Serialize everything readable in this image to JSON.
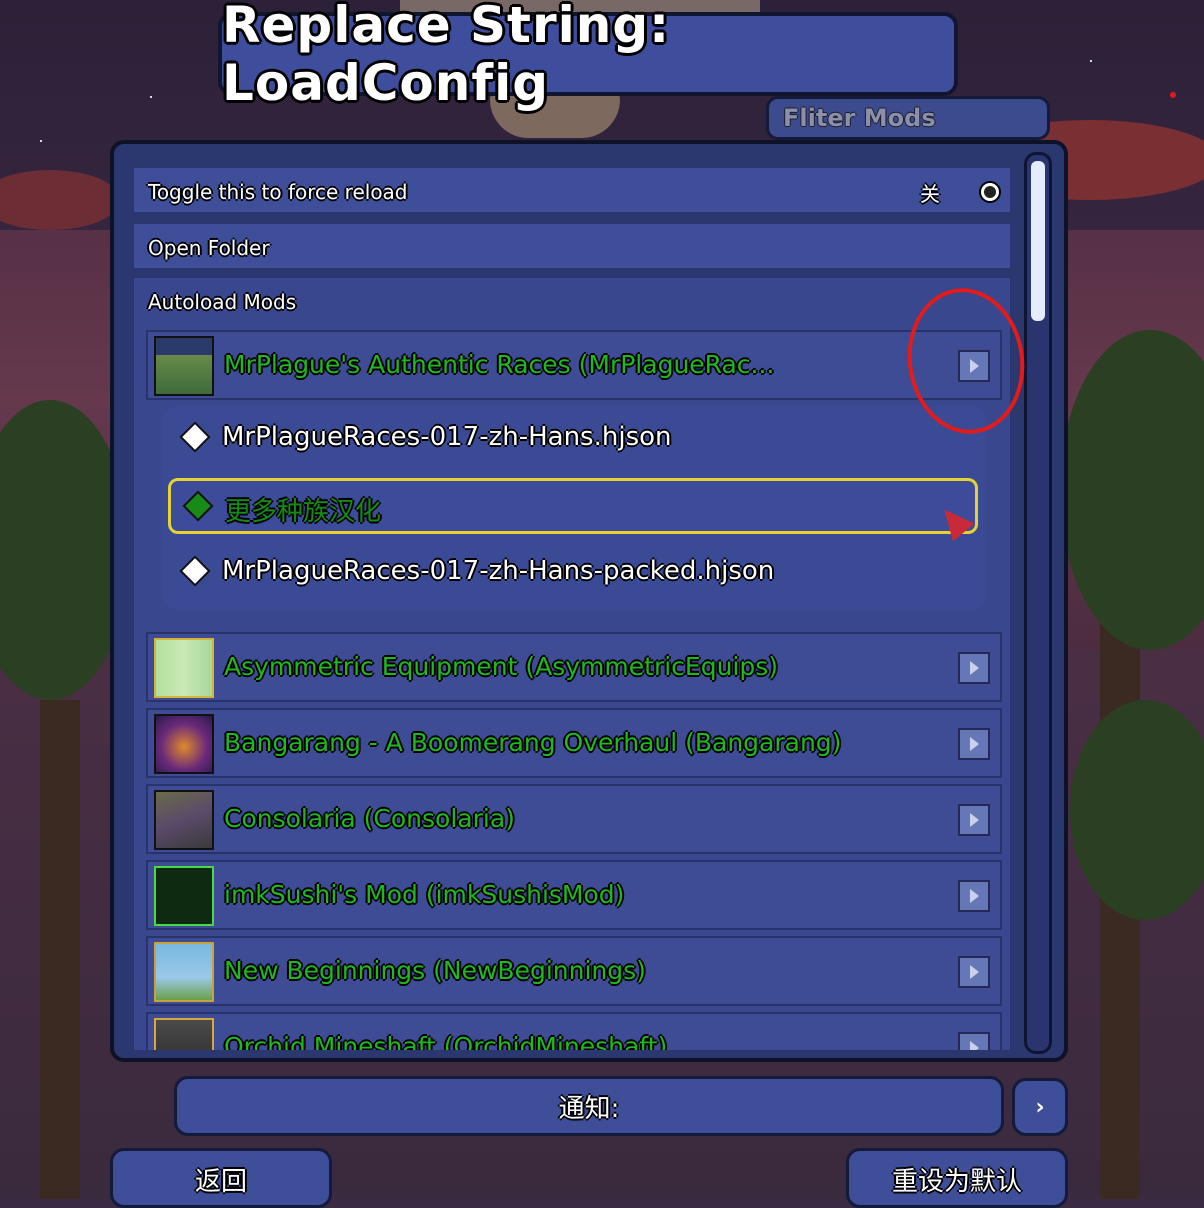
{
  "title": "Replace String: LoadConfig",
  "filter_label": "Fliter Mods",
  "rows": {
    "toggle_label": "Toggle this to force reload",
    "toggle_state": "关",
    "open_folder": "Open Folder",
    "autoload_label": "Autoload Mods"
  },
  "mods": [
    {
      "name": "MrPlague's Authentic Races (MrPlagueRac...",
      "icon": "races-icon",
      "expanded": true
    },
    {
      "name": "Asymmetric Equipment (AsymmetricEquips)",
      "icon": "asymmetric-icon"
    },
    {
      "name": "Bangarang - A Boomerang Overhaul (Bangarang)",
      "icon": "bangarang-icon"
    },
    {
      "name": "Consolaria (Consolaria)",
      "icon": "consolaria-icon"
    },
    {
      "name": "imkSushi's Mod (imkSushisMod)",
      "icon": "imksushi-icon"
    },
    {
      "name": "New Beginnings (NewBeginnings)",
      "icon": "new-beginnings-icon"
    },
    {
      "name": "Orchid Mineshaft (OrchidMineshaft)",
      "icon": "orchid-icon"
    }
  ],
  "files": [
    {
      "name": "MrPlagueRaces-017-zh-Hans.hjson",
      "selected": false
    },
    {
      "name": "更多种族汉化",
      "selected": true
    },
    {
      "name": "MrPlagueRaces-017-zh-Hans-packed.hjson",
      "selected": false
    }
  ],
  "notice": {
    "label": "通知:",
    "button": "›"
  },
  "buttons": {
    "back": "返回",
    "reset": "重设为默认"
  },
  "colors": {
    "panel": "#2b376f",
    "row": "#3f4e98",
    "mod_name": "#1fb81f",
    "selected_border": "#e6d231",
    "annotation": "#e31b1b"
  }
}
